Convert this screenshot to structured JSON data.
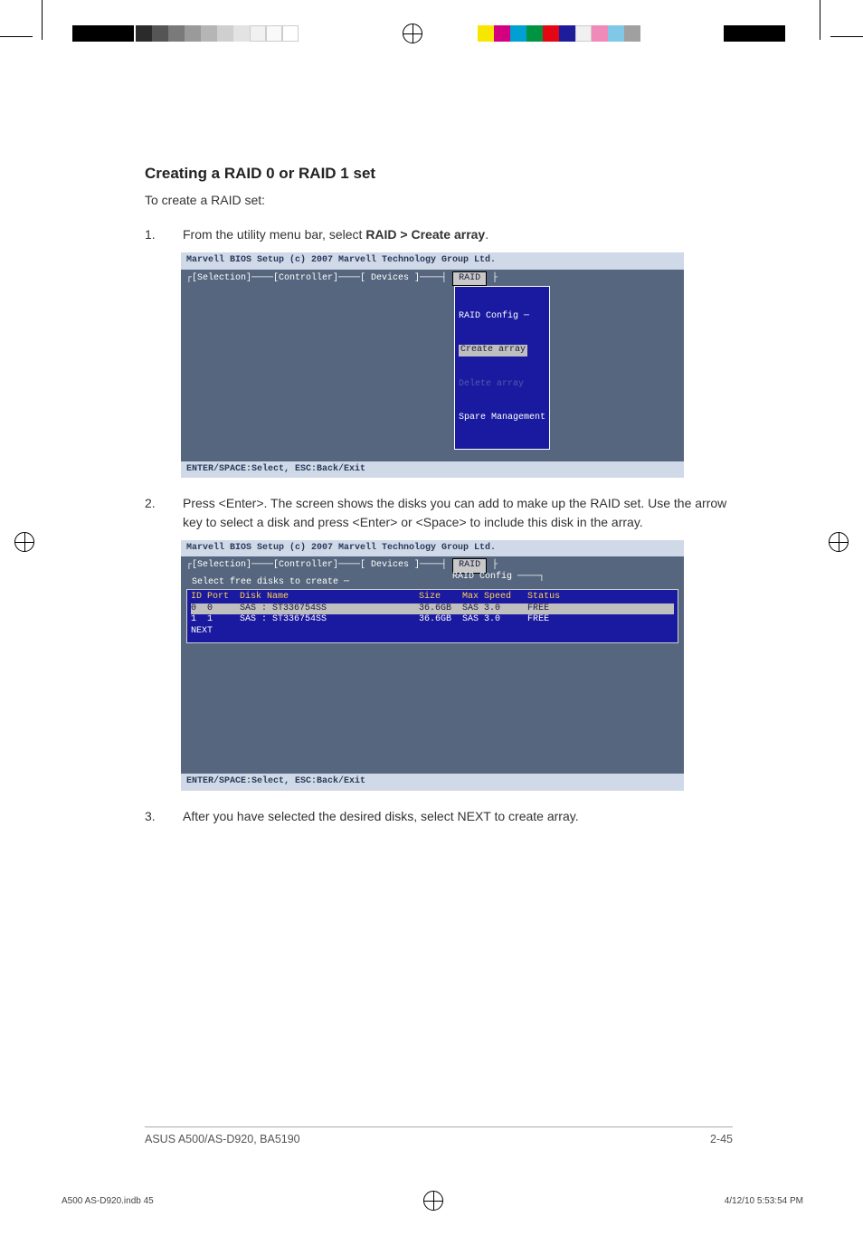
{
  "heading": "Creating a RAID 0 or RAID 1 set",
  "intro": "To create a RAID set:",
  "steps": [
    {
      "num": "1.",
      "text_pre": "From the utility menu bar, select ",
      "bold": "RAID > Create array",
      "text_post": "."
    },
    {
      "num": "2.",
      "text": "Press <Enter>. The screen shows the disks you can add to make up the RAID set. Use the arrow key to select a disk and press <Enter> or <Space> to include this disk in the array."
    },
    {
      "num": "3.",
      "text": "After you have selected the desired disks, select NEXT to create array."
    }
  ],
  "bios": {
    "title": "Marvell BIOS Setup (c) 2007 Marvell Technology Group Ltd.",
    "tabs": "┌[Selection]────[Controller]────[ Devices ]────",
    "raid_tab": "RAID",
    "footer": "ENTER/SPACE:Select, ESC:Back/Exit",
    "popup": {
      "title": "RAID Config ─",
      "items": [
        "Create array",
        "Delete array",
        "Spare Management"
      ],
      "selected_index": 0,
      "disabled_index": 1
    }
  },
  "bios2": {
    "raid_config": "RAID Config ────┐",
    "panel_title": "Select free disks to create ─",
    "columns": "ID Port  Disk Name                        Size    Max Speed   Status",
    "rows": [
      {
        "line": "0  0     SAS : ST336754SS                 36.6GB  SAS 3.0     FREE",
        "selected": true
      },
      {
        "line": "1  1     SAS : ST336754SS                 36.6GB  SAS 3.0     FREE",
        "selected": false
      }
    ],
    "next": "NEXT"
  },
  "page_footer_left": "ASUS A500/AS-D920, BA5190",
  "page_footer_right": "2-45",
  "print_footer_left": "A500 AS-D920.indb   45",
  "print_footer_right": "4/12/10   5:53:54 PM"
}
